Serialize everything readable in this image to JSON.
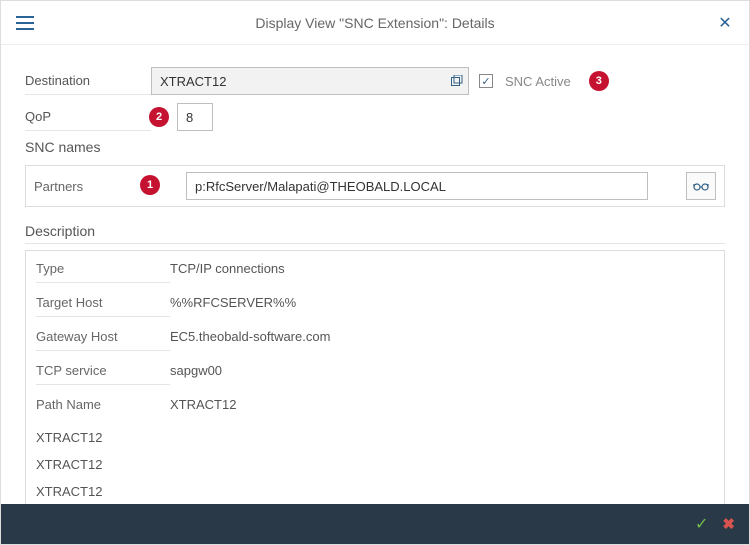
{
  "header": {
    "title": "Display View \"SNC Extension\": Details"
  },
  "fields": {
    "destination_label": "Destination",
    "destination_value": "XTRACT12",
    "snc_active_label": "SNC Active",
    "snc_active_checked": "✓",
    "qop_label": "QoP",
    "qop_value": "8"
  },
  "badges": {
    "b1": "1",
    "b2": "2",
    "b3": "3"
  },
  "snc": {
    "section_title": "SNC names",
    "partners_label": "Partners",
    "partners_value": "p:RfcServer/Malapati@THEOBALD.LOCAL"
  },
  "description": {
    "title": "Description",
    "rows": [
      {
        "key": "Type",
        "val": "TCP/IP connections"
      },
      {
        "key": "Target Host",
        "val": "%%RFCSERVER%%"
      },
      {
        "key": "Gateway Host",
        "val": "EC5.theobald-software.com"
      },
      {
        "key": "TCP service",
        "val": "sapgw00"
      },
      {
        "key": "Path Name",
        "val": "XTRACT12"
      }
    ],
    "extra": [
      "XTRACT12",
      "XTRACT12",
      "XTRACT12"
    ]
  }
}
